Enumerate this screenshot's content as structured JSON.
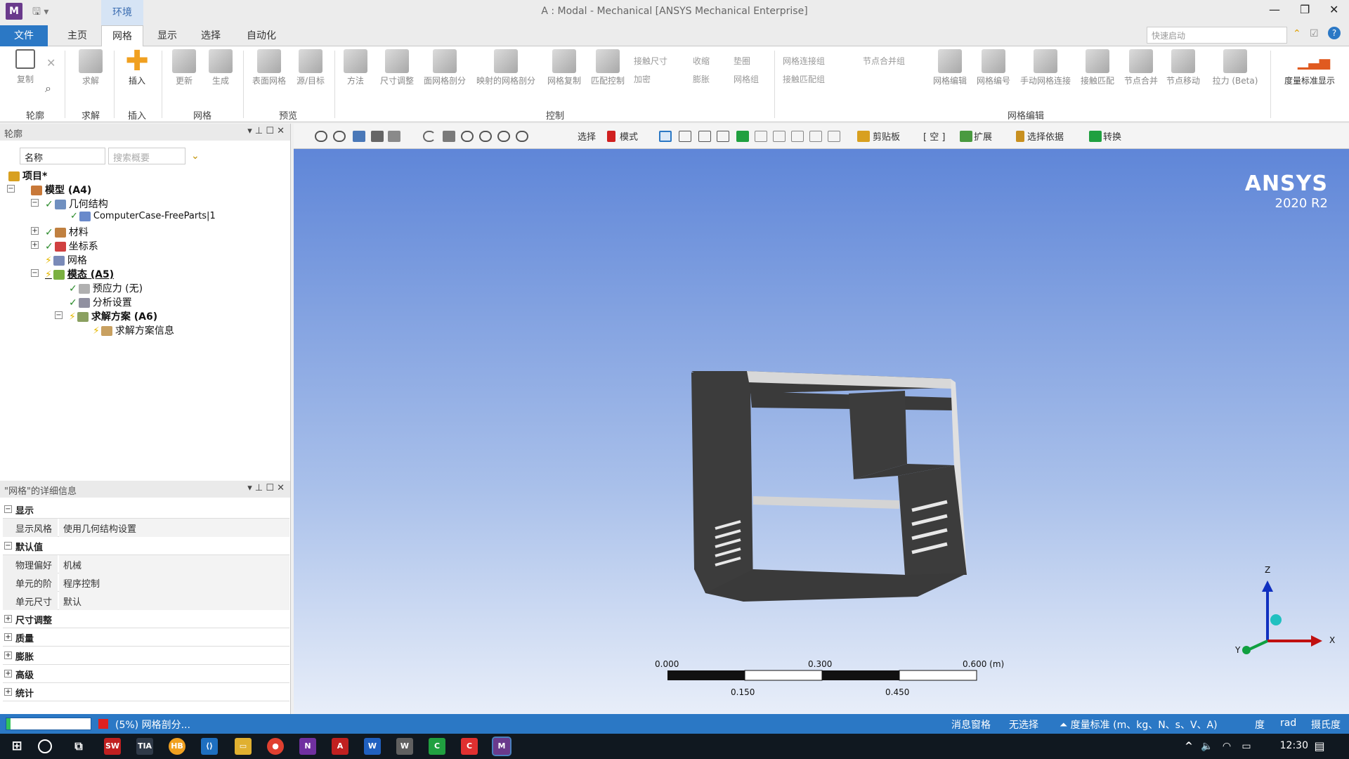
{
  "window": {
    "title": "A : Modal - Mechanical [ANSYS Mechanical Enterprise]",
    "context_tab": "环境",
    "app_icon_letter": "M"
  },
  "ribbon_tabs": [
    "文件",
    "主页",
    "网格",
    "显示",
    "选择",
    "自动化"
  ],
  "active_tab": "网格",
  "quick_launch_placeholder": "快速启动",
  "ribbon": {
    "outline_group": {
      "copy": "复制",
      "label": "轮廓"
    },
    "solve_group": {
      "solve": "求解",
      "label": "求解"
    },
    "insert_group": {
      "insert": "插入",
      "label": "插入"
    },
    "mesh_group": {
      "update": "更新",
      "generate": "生成",
      "label": "网格"
    },
    "preview_group": {
      "surface_mesh": "表面网格",
      "source_target": "源/目标",
      "label": "预览"
    },
    "control_group": {
      "method": "方法",
      "sizing": "尺寸调整",
      "face_meshing": "面网格剖分",
      "mapped_face": "映射的网格剖分",
      "mesh_copy": "网格复制",
      "match_control": "匹配控制",
      "contact_sizing": "接触尺寸",
      "refinement": "加密",
      "pinch": "收缩",
      "inflation": "膨胀",
      "gasket": "垫圈",
      "mesh_group": "网格组",
      "label": "控制"
    },
    "mesh_edit_group": {
      "mesh_connection_group": "网格连接组",
      "contact_match_group": "接触匹配组",
      "node_merge_group": "节点合并组",
      "mesh_edit": "网格编辑",
      "mesh_numbering": "网格编号",
      "manual_mesh_connection": "手动网格连接",
      "contact_match": "接触匹配",
      "node_merge": "节点合并",
      "node_move": "节点移动",
      "pull_beta": "拉力 (Beta)",
      "label": "网格编辑"
    },
    "metric_display": "度量标准显示"
  },
  "outline": {
    "title": "轮廓",
    "filter_value": "名称",
    "search_placeholder": "搜索概要",
    "tree": [
      {
        "label": "项目*"
      },
      {
        "label": "模型 (A4)"
      },
      {
        "label": "几何结构"
      },
      {
        "label": "ComputerCase-FreeParts|1"
      },
      {
        "label": "材料"
      },
      {
        "label": "坐标系"
      },
      {
        "label": "网格"
      },
      {
        "label": "模态 (A5)"
      },
      {
        "label": "预应力 (无)"
      },
      {
        "label": "分析设置"
      },
      {
        "label": "求解方案 (A6)"
      },
      {
        "label": "求解方案信息"
      }
    ]
  },
  "details": {
    "title": "\"网格\"的详细信息",
    "rows": [
      {
        "type": "section",
        "label": "显示",
        "sign": "−"
      },
      {
        "type": "prop",
        "key": "显示风格",
        "value": "使用几何结构设置"
      },
      {
        "type": "section",
        "label": "默认值",
        "sign": "−"
      },
      {
        "type": "prop",
        "key": "物理偏好",
        "value": "机械"
      },
      {
        "type": "prop",
        "key": "单元的阶",
        "value": "程序控制"
      },
      {
        "type": "prop",
        "key": "单元尺寸",
        "value": "默认"
      },
      {
        "type": "section",
        "label": "尺寸调整",
        "sign": "+"
      },
      {
        "type": "section",
        "label": "质量",
        "sign": "+"
      },
      {
        "type": "section",
        "label": "膨胀",
        "sign": "+"
      },
      {
        "type": "section",
        "label": "高级",
        "sign": "+"
      },
      {
        "type": "section",
        "label": "统计",
        "sign": "+"
      }
    ]
  },
  "viewport_toolbar": {
    "select": "选择",
    "mode": "模式",
    "clipboard": "剪贴板",
    "empty": "[ 空 ]",
    "extend": "扩展",
    "select_by": "选择依据",
    "convert": "转换"
  },
  "viewport": {
    "logo_main": "ANSYS",
    "logo_version": "2020 R2",
    "scale_labels_top": [
      "0.000",
      "0.300",
      "0.600 (m)"
    ],
    "scale_labels_bottom": [
      "0.150",
      "0.450"
    ],
    "axes": {
      "z": "Z",
      "x": "X",
      "y": "Y"
    }
  },
  "statusbar": {
    "progress_fraction": 0.05,
    "message": "(5%) 网格剖分...",
    "message_pane": "消息窗格",
    "no_selection": "无选择",
    "units": "度量标准 (m、kg、N、s、V、A)",
    "deg": "度",
    "rad": "rad",
    "temp": "摄氏度"
  },
  "taskbar": {
    "clock": "12:30"
  },
  "colors": {
    "accent": "#2b78c5",
    "viewport_top": "#5f86d8",
    "model_dark": "#3c3c3c"
  }
}
